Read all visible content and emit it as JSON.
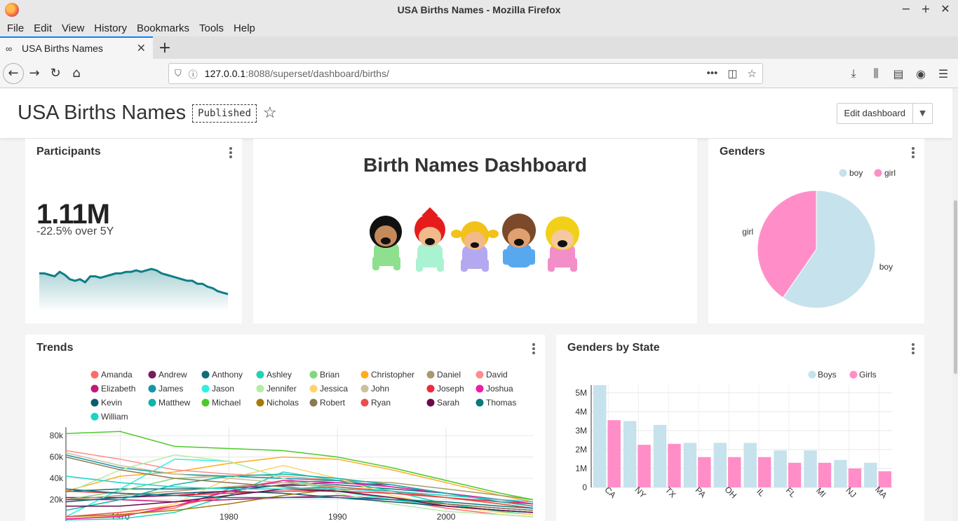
{
  "window": {
    "title": "USA Births Names - Mozilla Firefox"
  },
  "menu": [
    {
      "label": "File",
      "accel": "F"
    },
    {
      "label": "Edit",
      "accel": "E"
    },
    {
      "label": "View",
      "accel": "V"
    },
    {
      "label": "History",
      "accel": "H"
    },
    {
      "label": "Bookmarks",
      "accel": "B"
    },
    {
      "label": "Tools",
      "accel": "T"
    },
    {
      "label": "Help",
      "accel": "H"
    }
  ],
  "tab": {
    "label": "USA Births Names"
  },
  "url": {
    "host": "127.0.0.1",
    "rest": ":8088/superset/dashboard/births/"
  },
  "dashboard": {
    "title": "USA Births Names",
    "status": "Published",
    "edit_label": "Edit dashboard"
  },
  "participants": {
    "title": "Participants",
    "value": "1.11M",
    "change": "-22.5% over 5Y",
    "trend": [
      62,
      62,
      61,
      60,
      63,
      61,
      58,
      57,
      58,
      56,
      60,
      60,
      59,
      60,
      61,
      62,
      62,
      63,
      63,
      64,
      63,
      64,
      65,
      64,
      62,
      61,
      60,
      59,
      58,
      57,
      57,
      55,
      55,
      53,
      52,
      50,
      49,
      48
    ]
  },
  "markdown": {
    "title": "Birth Names Dashboard"
  },
  "colors": {
    "boy": "#c6e2ec",
    "girl": "#ff8ec8",
    "sparkline": "#0d7e86"
  },
  "genders_chart": {
    "title": "Genders",
    "chart_data": {
      "type": "pie",
      "labels": [
        "boy",
        "girl"
      ],
      "values": [
        0.596,
        0.404
      ],
      "legend": "top-right"
    }
  },
  "trends_chart": {
    "title": "Trends",
    "chart_data": {
      "type": "line",
      "x": [
        1965,
        1970,
        1975,
        1980,
        1985,
        1990,
        1995,
        2000,
        2005,
        2008
      ],
      "xticks": [
        "1970",
        "1980",
        "1990",
        "2000"
      ],
      "yticks": [
        "20k",
        "40k",
        "60k",
        "80k"
      ],
      "ylim": [
        0,
        88000
      ],
      "series": [
        {
          "name": "Amanda",
          "color": "#ff6b6b",
          "values": [
            2000,
            5000,
            12000,
            30000,
            38000,
            30000,
            20000,
            12000,
            6000,
            4000
          ]
        },
        {
          "name": "Andrew",
          "color": "#7a1a5a",
          "values": [
            22000,
            22000,
            24000,
            28000,
            34000,
            36000,
            34000,
            26000,
            18000,
            14000
          ]
        },
        {
          "name": "Anthony",
          "color": "#0e6e7a",
          "values": [
            28000,
            30000,
            30000,
            31000,
            33000,
            34000,
            30000,
            26000,
            20000,
            16000
          ]
        },
        {
          "name": "Ashley",
          "color": "#20d4b4",
          "values": [
            1000,
            2000,
            8000,
            24000,
            46000,
            38000,
            28000,
            16000,
            9000,
            6000
          ]
        },
        {
          "name": "Brian",
          "color": "#7ed87e",
          "values": [
            20000,
            28000,
            40000,
            42000,
            40000,
            30000,
            20000,
            14000,
            10000,
            8000
          ]
        },
        {
          "name": "Christopher",
          "color": "#ffad1f",
          "values": [
            28000,
            42000,
            46000,
            54000,
            60000,
            58000,
            48000,
            36000,
            24000,
            18000
          ]
        },
        {
          "name": "Daniel",
          "color": "#a89a6e",
          "values": [
            20000,
            24000,
            28000,
            32000,
            36000,
            38000,
            36000,
            30000,
            24000,
            20000
          ]
        },
        {
          "name": "David",
          "color": "#ff8c8c",
          "values": [
            66000,
            58000,
            48000,
            44000,
            42000,
            38000,
            32000,
            26000,
            20000,
            16000
          ]
        },
        {
          "name": "Elizabeth",
          "color": "#c2187a",
          "values": [
            20000,
            20000,
            18000,
            20000,
            22000,
            24000,
            20000,
            16000,
            12000,
            10000
          ]
        },
        {
          "name": "James",
          "color": "#1397a8",
          "values": [
            62000,
            50000,
            44000,
            42000,
            40000,
            38000,
            32000,
            26000,
            20000,
            16000
          ]
        },
        {
          "name": "Jason",
          "color": "#2ef0e0",
          "values": [
            4000,
            30000,
            58000,
            56000,
            40000,
            28000,
            20000,
            14000,
            10000,
            8000
          ]
        },
        {
          "name": "Jennifer",
          "color": "#b6eaa8",
          "values": [
            26000,
            48000,
            62000,
            56000,
            40000,
            26000,
            16000,
            9000,
            6000,
            4000
          ]
        },
        {
          "name": "Jessica",
          "color": "#ffd36b",
          "values": [
            2000,
            6000,
            16000,
            40000,
            52000,
            40000,
            24000,
            14000,
            8000,
            6000
          ]
        },
        {
          "name": "John",
          "color": "#cbbf9e",
          "values": [
            64000,
            52000,
            44000,
            40000,
            36000,
            32000,
            26000,
            22000,
            18000,
            14000
          ]
        },
        {
          "name": "Joseph",
          "color": "#f2283e",
          "values": [
            28000,
            26000,
            24000,
            26000,
            28000,
            28000,
            26000,
            22000,
            18000,
            16000
          ]
        },
        {
          "name": "Joshua",
          "color": "#f21aa8",
          "values": [
            2000,
            4000,
            14000,
            28000,
            38000,
            36000,
            32000,
            26000,
            20000,
            16000
          ]
        },
        {
          "name": "Kevin",
          "color": "#0e5a6e",
          "values": [
            18000,
            22000,
            26000,
            28000,
            26000,
            22000,
            18000,
            14000,
            10000,
            8000
          ]
        },
        {
          "name": "Matthew",
          "color": "#12b3a8",
          "values": [
            10000,
            20000,
            34000,
            42000,
            44000,
            40000,
            34000,
            26000,
            18000,
            14000
          ]
        },
        {
          "name": "Michael",
          "color": "#4dc92a",
          "values": [
            82000,
            84000,
            70000,
            68000,
            66000,
            60000,
            50000,
            38000,
            26000,
            20000
          ]
        },
        {
          "name": "Nicholas",
          "color": "#a87a0a",
          "values": [
            4000,
            6000,
            10000,
            16000,
            24000,
            30000,
            28000,
            22000,
            16000,
            12000
          ]
        },
        {
          "name": "Robert",
          "color": "#8a7a52",
          "values": [
            60000,
            48000,
            40000,
            36000,
            32000,
            28000,
            22000,
            16000,
            12000,
            10000
          ]
        },
        {
          "name": "Ryan",
          "color": "#e8504e",
          "values": [
            4000,
            8000,
            14000,
            24000,
            30000,
            32000,
            28000,
            22000,
            16000,
            12000
          ]
        },
        {
          "name": "Sarah",
          "color": "#6a0a4a",
          "values": [
            14000,
            14000,
            18000,
            24000,
            30000,
            28000,
            22000,
            14000,
            10000,
            8000
          ]
        },
        {
          "name": "Thomas",
          "color": "#077a7e",
          "values": [
            30000,
            26000,
            24000,
            22000,
            22000,
            22000,
            20000,
            18000,
            14000,
            12000
          ]
        },
        {
          "name": "William",
          "color": "#1ad4c8",
          "values": [
            42000,
            36000,
            32000,
            30000,
            30000,
            30000,
            28000,
            24000,
            20000,
            18000
          ]
        }
      ]
    }
  },
  "state_chart": {
    "title": "Genders by State",
    "chart_data": {
      "type": "bar",
      "categories": [
        "CA",
        "NY",
        "TX",
        "PA",
        "OH",
        "IL",
        "FL",
        "MI",
        "NJ",
        "MA"
      ],
      "series": [
        {
          "name": "Boys",
          "values": [
            5400000,
            3500000,
            3300000,
            2350000,
            2350000,
            2350000,
            1950000,
            1950000,
            1450000,
            1300000
          ]
        },
        {
          "name": "Girls",
          "values": [
            3550000,
            2250000,
            2300000,
            1600000,
            1600000,
            1600000,
            1300000,
            1300000,
            1000000,
            850000
          ]
        }
      ],
      "yticks": [
        "0",
        "1M",
        "2M",
        "3M",
        "4M",
        "5M"
      ],
      "ylim": [
        0,
        5400000
      ],
      "legend": "top-right"
    }
  }
}
